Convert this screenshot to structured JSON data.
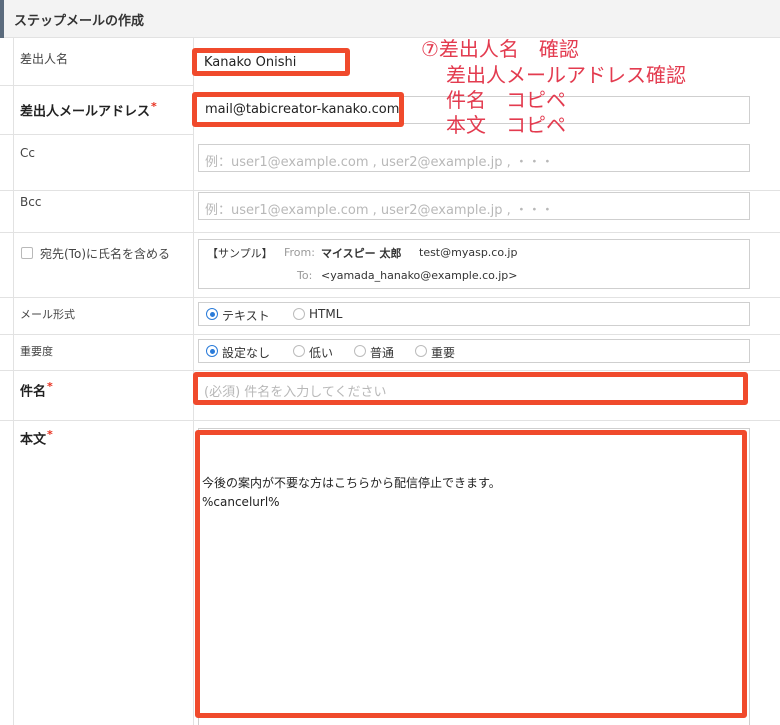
{
  "header": {
    "title": "ステップメールの作成"
  },
  "sender_name": {
    "label": "差出人名",
    "value": "Kanako Onishi"
  },
  "sender_email": {
    "label": "差出人メールアドレス",
    "value": "mail@tabicreator-kanako.com"
  },
  "cc": {
    "label": "Cc",
    "placeholder": "例：user1@example.com , user2@example.jp , ・・・"
  },
  "bcc": {
    "label": "Bcc",
    "placeholder": "例：user1@example.com , user2@example.jp , ・・・"
  },
  "to_name": {
    "checkbox_label": "宛先(To)に氏名を含める"
  },
  "sample": {
    "tag": "【サンプル】",
    "from_label": "From:",
    "from_name": "マイスピー 太郎",
    "from_email": "test@myasp.co.jp",
    "to_label": "To:",
    "to_email": "<yamada_hanako@example.co.jp>"
  },
  "mail_format": {
    "label": "メール形式",
    "options": [
      "テキスト",
      "HTML"
    ],
    "selected": "テキスト"
  },
  "priority": {
    "label": "重要度",
    "options": [
      "設定なし",
      "低い",
      "普通",
      "重要"
    ],
    "selected": "設定なし"
  },
  "subject": {
    "label": "件名",
    "placeholder": "(必須) 件名を入力してください"
  },
  "body": {
    "label": "本文",
    "line1": "今後の案内が不要な方はこちらから配信停止できます。",
    "line2": "%cancelurl%"
  },
  "annotation": {
    "line1": "⑦差出人名　確認",
    "line2": "差出人メールアドレス確認",
    "line3": "件名　コピペ",
    "line4": "本文　コピペ"
  },
  "colors": {
    "highlight": "#f04a2c",
    "annotation": "#e33b4f",
    "radio": "#2a7bd9",
    "required": "#e8301f"
  }
}
